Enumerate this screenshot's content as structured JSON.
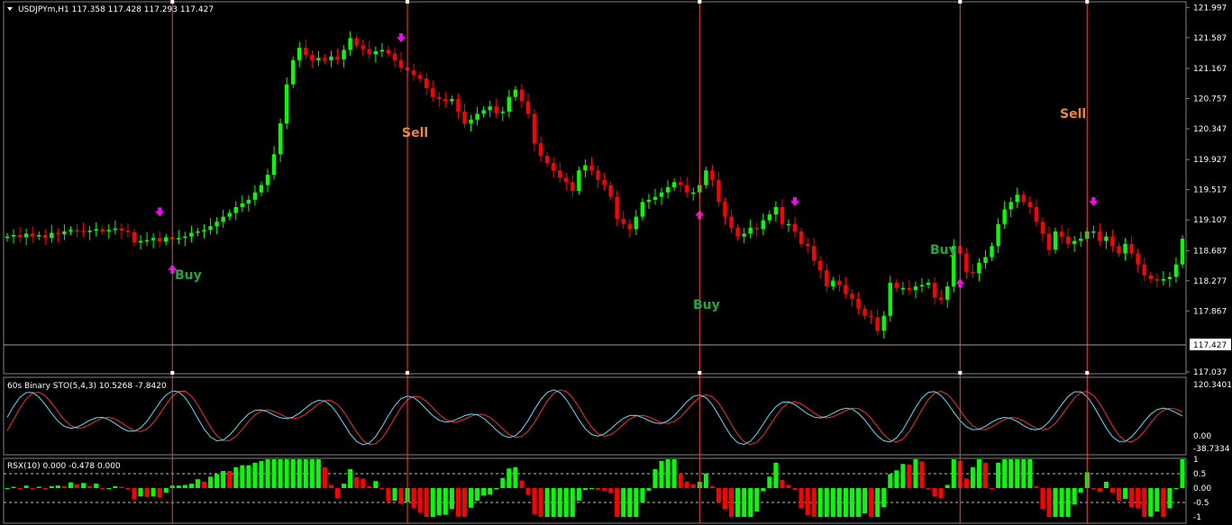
{
  "colors": {
    "bull": "#00ff00",
    "bear": "#ff0000",
    "arrow": "#ff00ff",
    "vline": "#ff3b3b",
    "buy": "#22a83a",
    "sell": "#f0873a",
    "sto_main": "#56e0ff",
    "sto_signal": "#ff2a2a",
    "grid": "#808080",
    "text": "#ffffff"
  },
  "main": {
    "title": "USDJPYm,H1  117.358 117.428 117.293 117.427",
    "menu_icon": "triangle-down-icon",
    "axis_labels": [
      "121.997",
      "121.587",
      "121.167",
      "120.757",
      "120.347",
      "119.927",
      "119.517",
      "119.107",
      "118.687",
      "118.277",
      "117.867",
      "117.037"
    ],
    "current_price": "117.427",
    "signals": [
      {
        "text": "Buy",
        "kind": "buy"
      },
      {
        "text": "Sell",
        "kind": "sell"
      },
      {
        "text": "Buy",
        "kind": "buy"
      },
      {
        "text": "Buy",
        "kind": "buy"
      },
      {
        "text": "Sell",
        "kind": "sell"
      }
    ]
  },
  "sto": {
    "title": "60s Binary STO(5,4,3) 10.5268 -7.8420",
    "axis_labels": [
      "120.3401",
      "0.00",
      "-38.7334"
    ]
  },
  "rsx": {
    "title": "RSX(10) 0.000 -0.478 0.000",
    "axis_labels": [
      "1",
      "0.5",
      "0.00",
      "-0.5",
      "-1"
    ]
  },
  "chart_data": {
    "type": "candlestick",
    "symbol": "USDJPYm",
    "timeframe": "H1",
    "close": [
      118.88,
      118.9,
      118.87,
      118.92,
      118.88,
      118.9,
      118.86,
      118.93,
      118.91,
      118.95,
      118.97,
      118.96,
      118.94,
      118.96,
      118.98,
      118.95,
      118.97,
      118.99,
      118.96,
      118.94,
      118.8,
      118.82,
      118.83,
      118.86,
      118.81,
      118.87,
      118.84,
      118.86,
      118.88,
      118.93,
      118.95,
      118.97,
      119.02,
      119.08,
      119.15,
      119.2,
      119.28,
      119.33,
      119.38,
      119.48,
      119.58,
      119.72,
      120.0,
      120.42,
      120.95,
      121.28,
      121.45,
      121.35,
      121.28,
      121.31,
      121.28,
      121.33,
      121.29,
      121.42,
      121.58,
      121.48,
      121.43,
      121.36,
      121.4,
      121.42,
      121.37,
      121.28,
      121.18,
      121.14,
      121.08,
      121.03,
      120.9,
      120.78,
      120.75,
      120.72,
      120.75,
      120.58,
      120.42,
      120.47,
      120.55,
      120.6,
      120.65,
      120.56,
      120.58,
      120.78,
      120.88,
      120.72,
      120.55,
      120.15,
      119.98,
      119.88,
      119.78,
      119.68,
      119.62,
      119.5,
      119.78,
      119.85,
      119.78,
      119.65,
      119.58,
      119.42,
      119.12,
      119.05,
      118.98,
      119.15,
      119.35,
      119.38,
      119.42,
      119.48,
      119.55,
      119.62,
      119.58,
      119.48,
      119.48,
      119.58,
      119.78,
      119.65,
      119.35,
      119.15,
      119.0,
      118.88,
      118.92,
      119.0,
      118.98,
      119.1,
      119.18,
      119.28,
      119.05,
      119.05,
      118.95,
      118.78,
      118.75,
      118.55,
      118.42,
      118.2,
      118.28,
      118.22,
      118.1,
      118.03,
      117.9,
      117.8,
      117.78,
      117.6,
      117.8,
      118.25,
      118.18,
      118.18,
      118.15,
      118.2,
      118.22,
      118.25,
      118.05,
      118.02,
      118.2,
      118.75,
      118.65,
      118.4,
      118.38,
      118.52,
      118.6,
      118.75,
      119.05,
      119.25,
      119.35,
      119.45,
      119.35,
      119.28,
      119.08,
      118.92,
      118.7,
      118.95,
      118.88,
      118.78,
      118.82,
      118.85,
      118.95,
      118.95,
      118.82,
      118.88,
      118.75,
      118.65,
      118.78,
      118.65,
      118.5,
      118.35,
      118.3,
      118.28,
      118.3,
      118.33,
      118.5,
      118.85
    ],
    "price_range": [
      117.037,
      122.05
    ],
    "vertical_lines_at_bar": [
      26,
      63,
      109,
      150,
      170
    ],
    "indicators": [
      "60s Binary STO(5,4,3)",
      "RSX(10)"
    ]
  }
}
